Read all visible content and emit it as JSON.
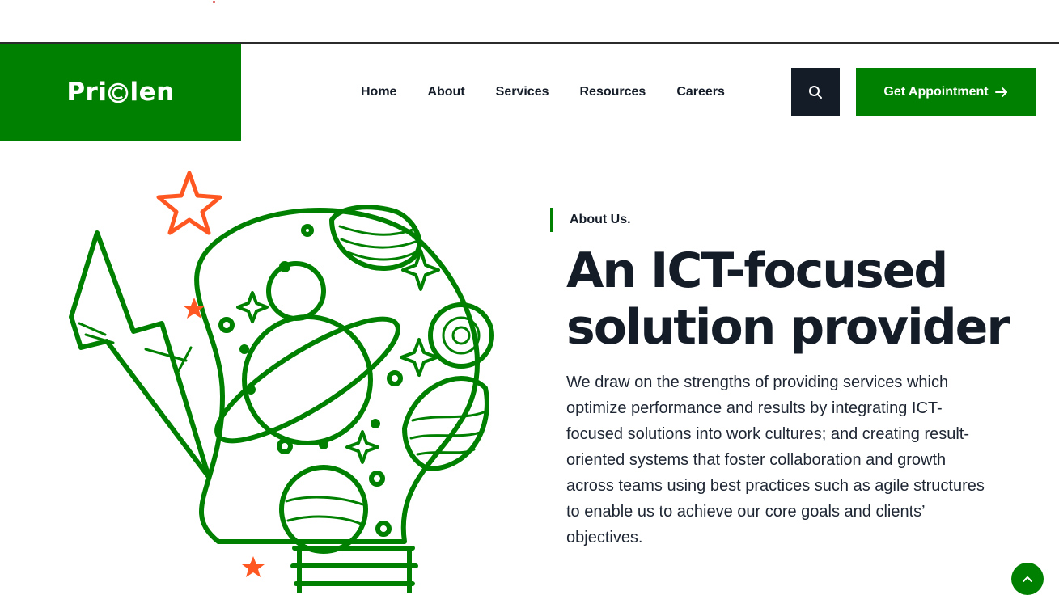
{
  "brand": {
    "logo_prefix": "Pri",
    "logo_suffix": "len",
    "accent": "#008000",
    "dark": "#141c28",
    "highlight": "#ff5722"
  },
  "nav": {
    "items": [
      "Home",
      "About",
      "Services",
      "Resources",
      "Careers"
    ]
  },
  "header": {
    "search_icon": "search-icon",
    "appointment_label": "Get Appointment",
    "appointment_icon": "arrow-right-icon"
  },
  "about": {
    "tag": "About Us.",
    "headline_line1": "An ICT-focused",
    "headline_line2": "solution provider",
    "description": "We draw on the strengths of providing services which optimize performance and results by integrating ICT-focused solutions into work cultures; and creating result-oriented systems that foster collaboration and growth across teams using best practices such as agile structures to enable us to achieve our core goals and clients’ objectives."
  },
  "scroll_top_icon": "chevron-up-icon"
}
